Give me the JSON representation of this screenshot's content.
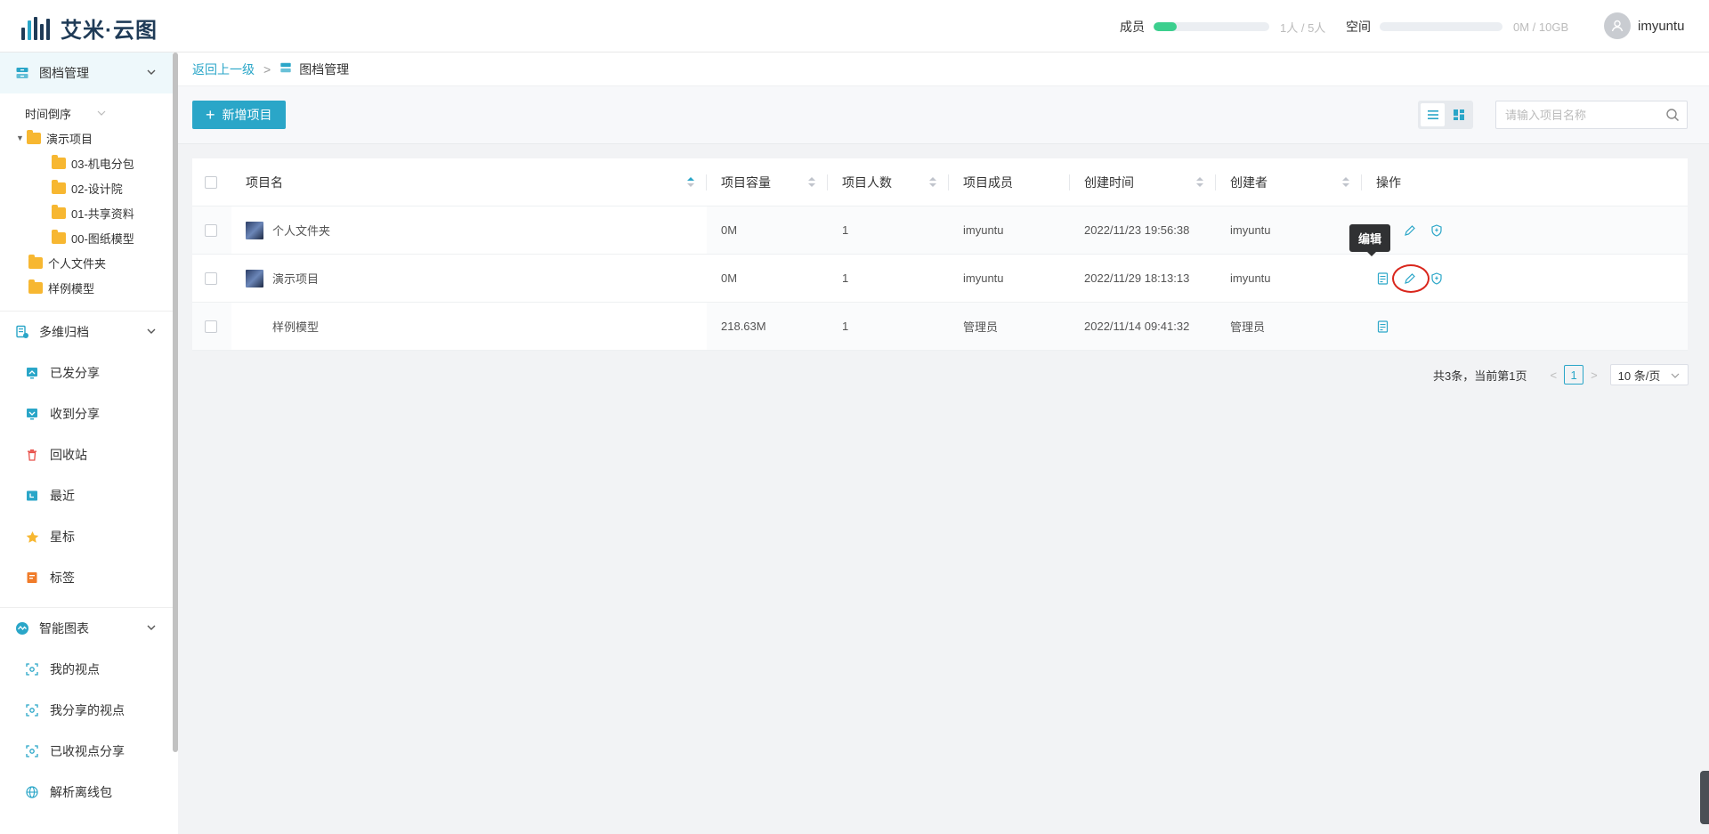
{
  "app": {
    "logo_text": "艾米·云图"
  },
  "header": {
    "members_label": "成员",
    "members_value": "1人 / 5人",
    "members_progress": 0.2,
    "space_label": "空间",
    "space_value": "0M / 10GB",
    "space_progress": 0,
    "username": "imyuntu"
  },
  "sidebar": {
    "archive": {
      "title": "图档管理",
      "sort_label": "时间倒序",
      "tree": [
        {
          "label": "演示项目",
          "level": 0,
          "expanded": true
        },
        {
          "label": "03-机电分包",
          "level": 1
        },
        {
          "label": "02-设计院",
          "level": 1
        },
        {
          "label": "01-共享资料",
          "level": 1
        },
        {
          "label": "00-图纸模型",
          "level": 1
        },
        {
          "label": "个人文件夹",
          "level": 0
        },
        {
          "label": "样例模型",
          "level": 0
        }
      ]
    },
    "multi": {
      "title": "多维归档",
      "items": [
        {
          "label": "已发分享",
          "icon": "sent-share-icon"
        },
        {
          "label": "收到分享",
          "icon": "received-share-icon"
        },
        {
          "label": "回收站",
          "icon": "trash-icon"
        },
        {
          "label": "最近",
          "icon": "recent-icon"
        },
        {
          "label": "星标",
          "icon": "star-icon"
        },
        {
          "label": "标签",
          "icon": "tag-icon"
        }
      ]
    },
    "smart": {
      "title": "智能图表",
      "items": [
        {
          "label": "我的视点",
          "icon": "viewpoint-icon"
        },
        {
          "label": "我分享的视点",
          "icon": "shared-viewpoint-icon"
        },
        {
          "label": "已收视点分享",
          "icon": "received-viewpoint-icon"
        },
        {
          "label": "解析离线包",
          "icon": "globe-icon"
        }
      ]
    }
  },
  "breadcrumb": {
    "back": "返回上一级",
    "separator": ">",
    "current": "图档管理"
  },
  "toolbar": {
    "add_label": "新增项目",
    "search_placeholder": "请输入项目名称"
  },
  "table": {
    "columns": [
      "项目名",
      "项目容量",
      "项目人数",
      "项目成员",
      "创建时间",
      "创建者",
      "操作"
    ],
    "rows": [
      {
        "name": "个人文件夹",
        "capacity": "0M",
        "count": "1",
        "members": "imyuntu",
        "created": "2022/11/23 19:56:38",
        "creator": "imyuntu",
        "has_thumb": true
      },
      {
        "name": "演示项目",
        "capacity": "0M",
        "count": "1",
        "members": "imyuntu",
        "created": "2022/11/29 18:13:13",
        "creator": "imyuntu",
        "has_thumb": true
      },
      {
        "name": "样例模型",
        "capacity": "218.63M",
        "count": "1",
        "members": "管理员",
        "created": "2022/11/14 09:41:32",
        "creator": "管理员",
        "has_thumb": false
      }
    ],
    "tooltip": "编辑"
  },
  "pagination": {
    "summary": "共3条，当前第1页",
    "prev": "<",
    "current_page": "1",
    "next": ">",
    "page_size": "10 条/页"
  },
  "colors": {
    "accent": "#2aa6c8",
    "progress": "#3ccf8e",
    "folder": "#f7b731",
    "highlight": "#d9261c"
  }
}
